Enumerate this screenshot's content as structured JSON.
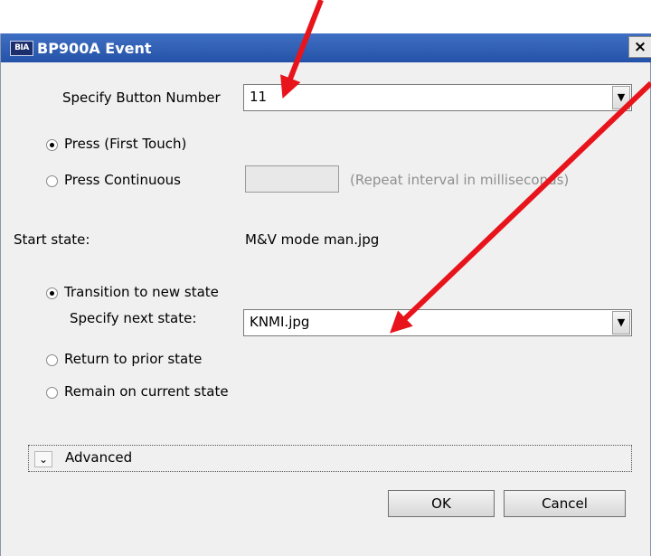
{
  "window": {
    "title": "BP900A Event",
    "app_icon": "BIA",
    "close_glyph": "×"
  },
  "button_number": {
    "label": "Specify Button Number",
    "value": "11"
  },
  "press_mode": {
    "first_touch_label": "Press (First Touch)",
    "first_touch_selected": true,
    "continuous_label": "Press Continuous",
    "continuous_selected": false,
    "repeat_interval_hint": "(Repeat interval in milliseconds)",
    "repeat_interval_value": ""
  },
  "start_state": {
    "label": "Start state:",
    "value": "M&V mode man.jpg"
  },
  "transition": {
    "new_state_label": "Transition to new state",
    "new_state_selected": true,
    "next_state_label": "Specify next state:",
    "next_state_value": "KNMI.jpg",
    "return_prior_label": "Return to prior state",
    "remain_current_label": "Remain on current state"
  },
  "advanced": {
    "label": "Advanced"
  },
  "buttons": {
    "ok": "OK",
    "cancel": "Cancel"
  },
  "annotation": {
    "arrow_color": "#e8141c"
  }
}
